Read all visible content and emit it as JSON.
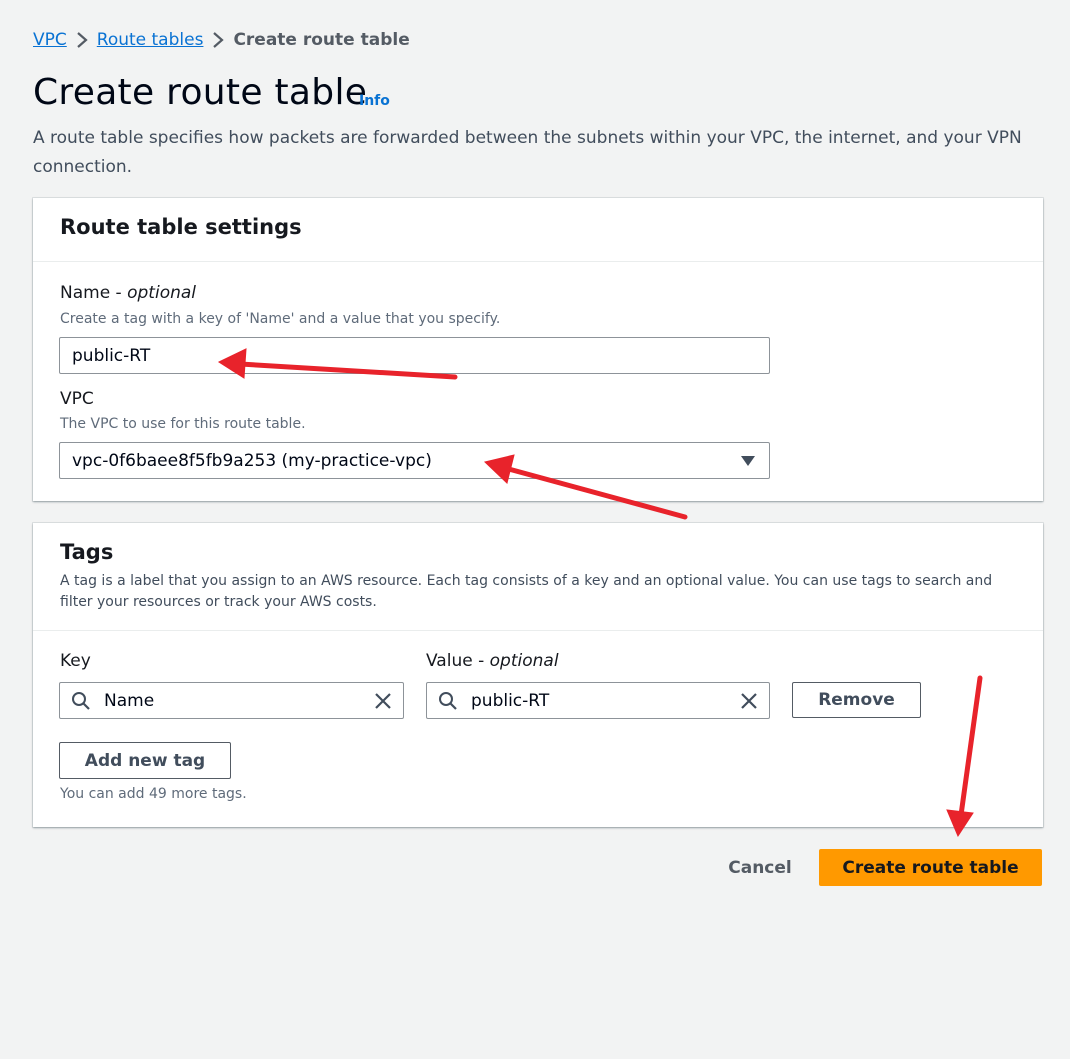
{
  "breadcrumb": {
    "items": [
      "VPC",
      "Route tables"
    ],
    "current": "Create route table"
  },
  "header": {
    "title": "Create route table",
    "info": "Info",
    "description": "A route table specifies how packets are forwarded between the subnets within your VPC, the internet, and your VPN connection."
  },
  "settings": {
    "title": "Route table settings",
    "name_label": "Name",
    "name_optional": "optional",
    "name_hint": "Create a tag with a key of 'Name' and a value that you specify.",
    "name_value": "public-RT",
    "vpc_label": "VPC",
    "vpc_hint": "The VPC to use for this route table.",
    "vpc_value": "vpc-0f6baee8f5fb9a253 (my-practice-vpc)"
  },
  "tags": {
    "title": "Tags",
    "description": "A tag is a label that you assign to an AWS resource. Each tag consists of a key and an optional value. You can use tags to search and filter your resources or track your AWS costs.",
    "key_label": "Key",
    "value_label": "Value",
    "value_optional": "optional",
    "rows": [
      {
        "key": "Name",
        "value": "public-RT"
      }
    ],
    "remove_label": "Remove",
    "add_label": "Add new tag",
    "remaining_hint": "You can add 49 more tags."
  },
  "footer": {
    "cancel_label": "Cancel",
    "create_label": "Create route table"
  },
  "colors": {
    "primary_button": "#ff9900",
    "link": "#0972d3",
    "annotation_arrow": "#e8232b"
  },
  "icons": [
    "chevron-right-icon",
    "dropdown-caret-icon",
    "search-icon",
    "clear-icon",
    "annotation-arrow"
  ]
}
